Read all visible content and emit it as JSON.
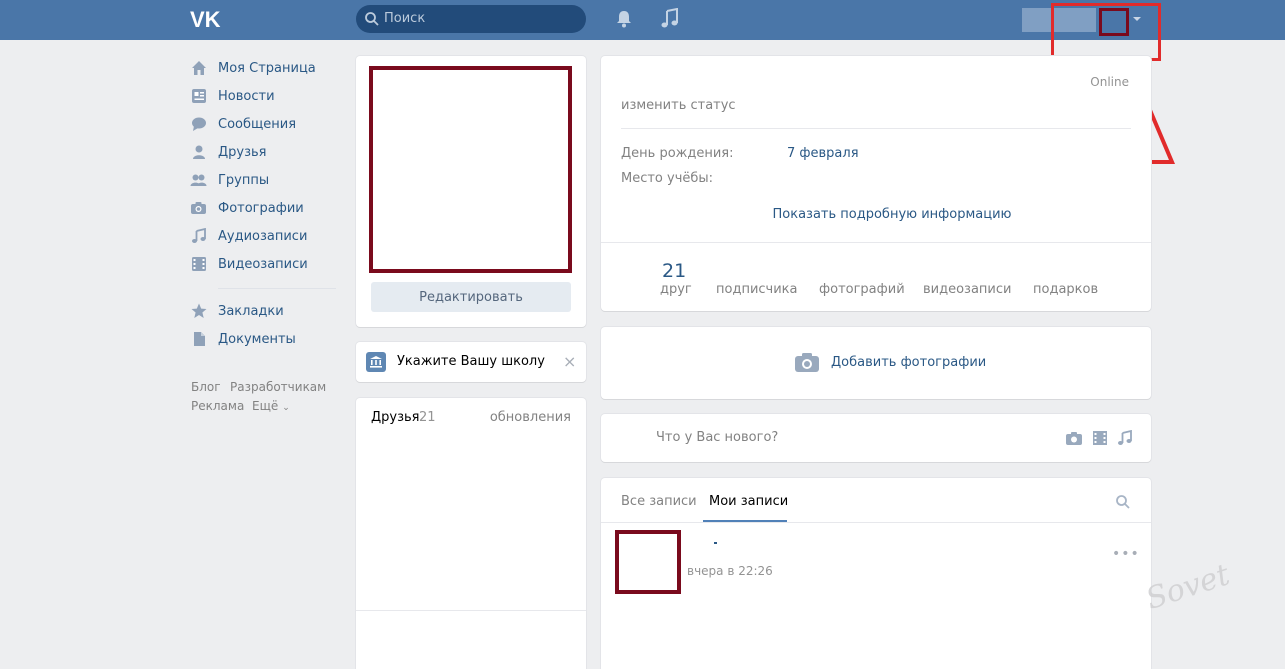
{
  "header": {
    "logo": "VK",
    "search_placeholder": "Поиск",
    "icons": [
      "bell-icon",
      "music-icon"
    ],
    "accent": "#4a76a8"
  },
  "menu": {
    "items": [
      {
        "label": "Моя Страница",
        "icon": "home-icon"
      },
      {
        "label": "Новости",
        "icon": "news-icon"
      },
      {
        "label": "Сообщения",
        "icon": "messages-icon"
      },
      {
        "label": "Друзья",
        "icon": "friends-icon"
      },
      {
        "label": "Группы",
        "icon": "groups-icon"
      },
      {
        "label": "Фотографии",
        "icon": "camera-icon"
      },
      {
        "label": "Аудиозаписи",
        "icon": "music-icon"
      },
      {
        "label": "Видеозаписи",
        "icon": "film-icon"
      },
      {
        "label": "Закладки",
        "icon": "star-icon"
      },
      {
        "label": "Документы",
        "icon": "document-icon"
      }
    ],
    "footer": {
      "blog": "Блог",
      "developers": "Разработчикам",
      "ads": "Реклама",
      "more": "Ещё"
    }
  },
  "profile": {
    "edit_button": "Редактировать",
    "school_prompt": "Укажите Вашу школу",
    "friends_title": "Друзья",
    "friends_count": "21",
    "friends_updates": "обновления"
  },
  "info": {
    "online": "Online",
    "status": "изменить статус",
    "birthday_label": "День рождения:",
    "birthday_value": "7 февраля",
    "school_label": "Место учёбы:",
    "more": "Показать подробную информацию",
    "counters": [
      {
        "num": "21",
        "label": "друг"
      },
      {
        "num": "",
        "label": "подписчика"
      },
      {
        "num": "",
        "label": "фотографий"
      },
      {
        "num": "",
        "label": "видеозаписи"
      },
      {
        "num": "",
        "label": "подарков"
      }
    ]
  },
  "add_photo": "Добавить фотографии",
  "new_post_placeholder": "Что у Вас нового?",
  "wall": {
    "tab_all": "Все записи",
    "tab_mine": "Мои записи",
    "post_time": "вчера в 22:26",
    "more": "•••"
  },
  "highlight_color": "#e12b2b",
  "mask_color": "#7a0a1d"
}
